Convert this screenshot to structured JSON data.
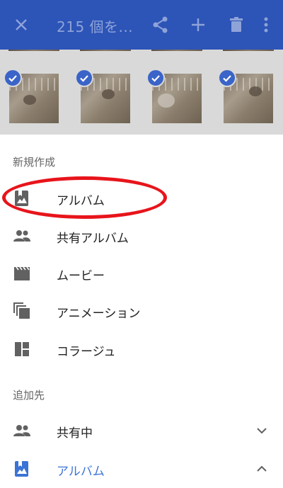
{
  "toolbar": {
    "title": "215 個を...",
    "close_icon": "close-icon",
    "share_icon": "share-icon",
    "add_icon": "add-icon",
    "delete_icon": "trash-icon",
    "more_icon": "more-vert-icon",
    "bg_color": "#2d54b7"
  },
  "sections": {
    "create_title": "新規作成",
    "add_to_title": "追加先"
  },
  "create_items": [
    {
      "label": "アルバム",
      "icon": "photo-album-icon"
    },
    {
      "label": "共有アルバム",
      "icon": "people-icon"
    },
    {
      "label": "ムービー",
      "icon": "movie-clapper-icon"
    },
    {
      "label": "アニメーション",
      "icon": "animation-icon"
    },
    {
      "label": "コラージュ",
      "icon": "collage-icon"
    }
  ],
  "add_to_items": [
    {
      "label": "共有中",
      "icon": "people-icon",
      "chevron": "chevron-down-icon"
    },
    {
      "label": "アルバム",
      "icon": "photo-album-icon",
      "chevron": "chevron-up-icon"
    }
  ],
  "colors": {
    "accent": "#3b73d6",
    "highlight": "#e8141b"
  }
}
